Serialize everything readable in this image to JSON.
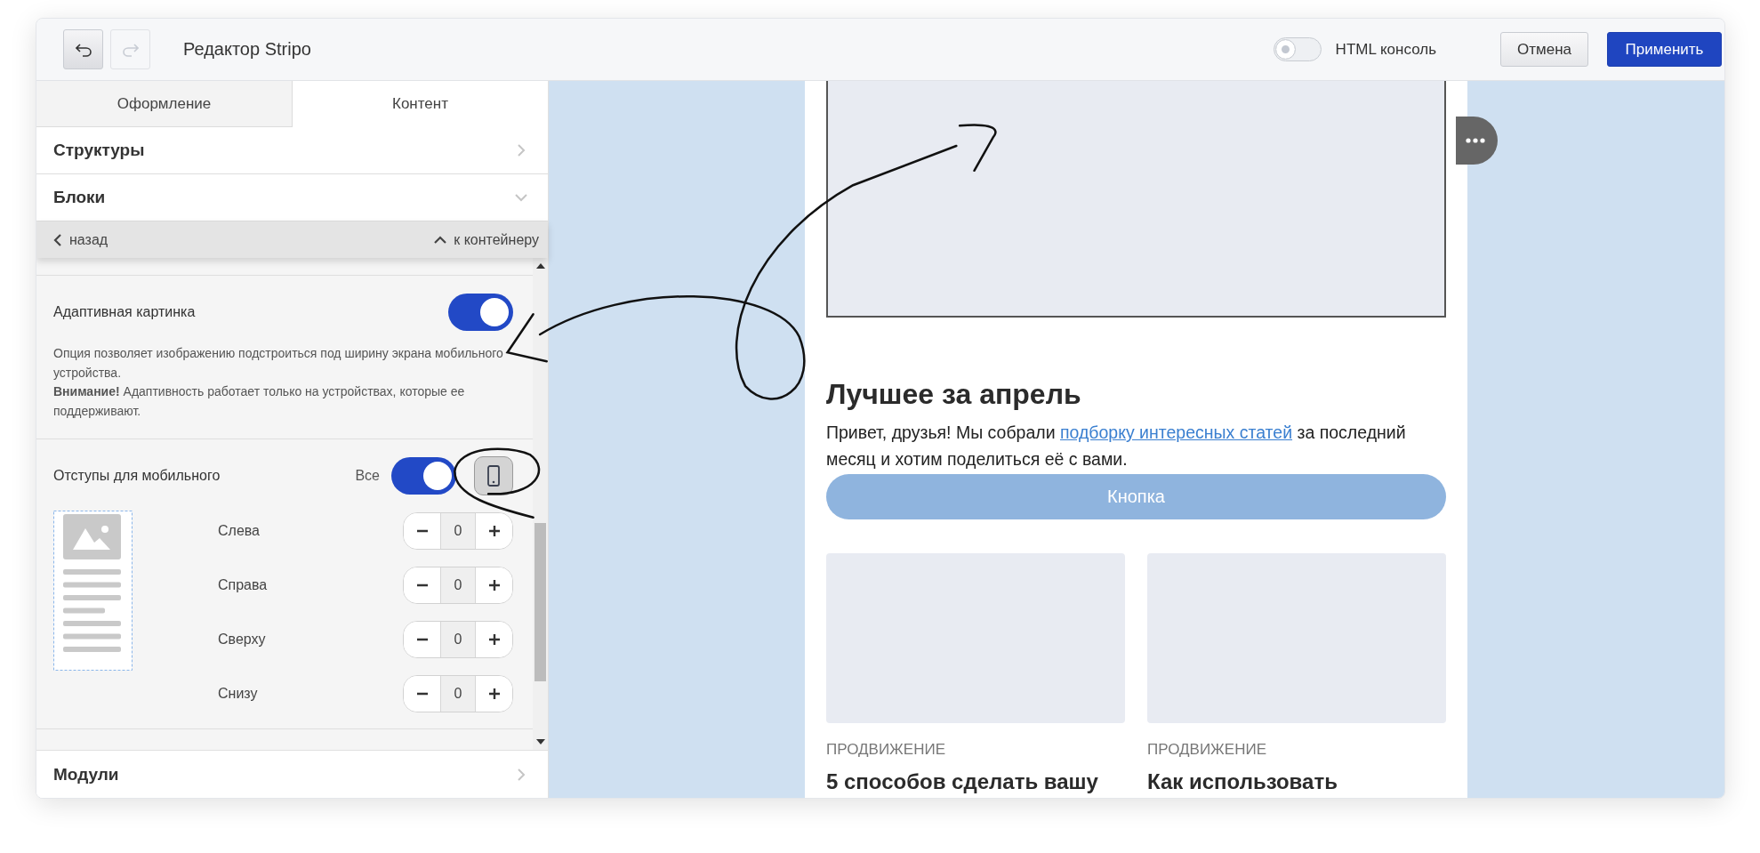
{
  "toolbar": {
    "undo": {
      "disabled": false
    },
    "redo": {
      "disabled": true
    },
    "title": "Редактор Stripo",
    "html_console": {
      "label": "HTML консоль",
      "on": false
    },
    "buttons": [
      {
        "label": "Отмена",
        "kind": "secondary"
      },
      {
        "label": "Применить",
        "kind": "primary"
      }
    ]
  },
  "panel": {
    "tabs": [
      {
        "label": "Оформление",
        "selected": false
      },
      {
        "label": "Контент",
        "selected": true
      }
    ],
    "sections_top": [
      {
        "title": "Структуры",
        "expanded": false
      },
      {
        "title": "Блоки",
        "expanded": true
      }
    ],
    "nav": {
      "back": "назад",
      "up": "к контейнеру"
    },
    "adaptive": {
      "label": "Адаптивная картинка",
      "on": true,
      "description": [
        "Опция позволяет изображению подстроиться под ширину экрана мобильного устройства.",
        "**Внимание!** Адаптивность работает только на устройствах, которые ее поддерживают."
      ]
    },
    "mobile_padding": {
      "label": "Отступы для мобильного",
      "all_label": "Все",
      "all_on": true,
      "device_selected": true,
      "fields": [
        {
          "label": "Слева",
          "value": "0"
        },
        {
          "label": "Справа",
          "value": "0"
        },
        {
          "label": "Сверху",
          "value": "0"
        },
        {
          "label": "Снизу",
          "value": "0"
        }
      ]
    },
    "sections_bottom": [
      {
        "title": "Модули",
        "expanded": false
      }
    ]
  },
  "email": {
    "heading": "Лучшее за апрель",
    "intro_before": "Привет, друзья! Мы собрали",
    "intro_link": "подборку интересных статей",
    "intro_after": "за последний месяц и хотим поделиться её с вами.",
    "button": "Кнопка",
    "articles": [
      {
        "category": "ПРОДВИЖЕНИЕ",
        "title": "5 способов сделать вашу"
      },
      {
        "category": "ПРОДВИЖЕНИЕ",
        "title": "Как использовать"
      }
    ]
  }
}
